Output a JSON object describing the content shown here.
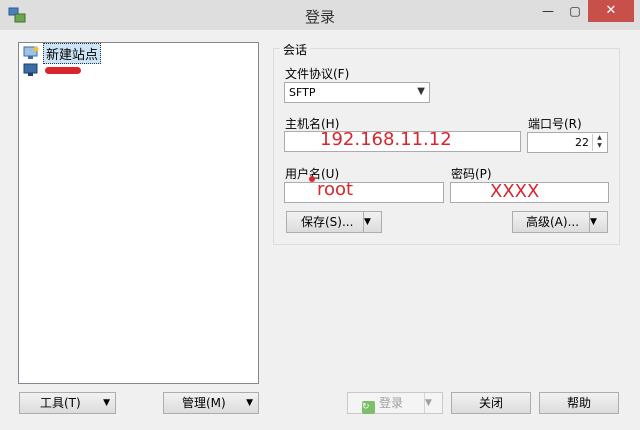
{
  "window": {
    "title": "登录",
    "minimize_glyph": "—",
    "maximize_glyph": "▢",
    "close_glyph": "✕"
  },
  "sites": {
    "items": [
      {
        "label": "新建站点",
        "icon": "new-site-icon"
      },
      {
        "label": "",
        "icon": "computer-icon"
      }
    ]
  },
  "session": {
    "group_title": "会话",
    "protocol_label": "文件协议(F)",
    "protocol_value": "SFTP",
    "host_label": "主机名(H)",
    "host_value": "192.168.11.12",
    "port_label": "端口号(R)",
    "port_value": "22",
    "user_label": "用户名(U)",
    "user_value": "root",
    "password_label": "密码(P)",
    "password_value": "XXXX",
    "save_label": "保存(S)...",
    "advanced_label": "高级(A)..."
  },
  "footer": {
    "tools_label": "工具(T)",
    "manage_label": "管理(M)",
    "login_label": "登录",
    "close_label": "关闭",
    "help_label": "帮助"
  },
  "colors": {
    "annotation_red": "#d8262c",
    "close_button": "#c7504a"
  }
}
